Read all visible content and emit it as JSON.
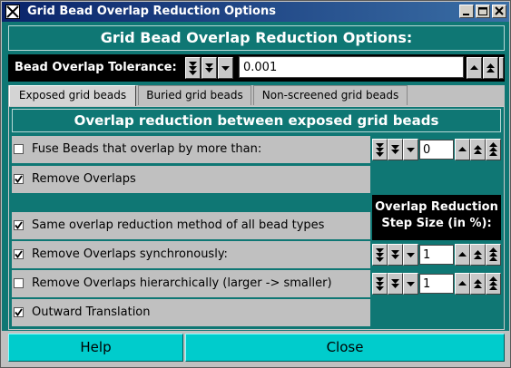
{
  "window": {
    "title": "Grid Bead Overlap Reduction Options"
  },
  "header": {
    "title": "Grid Bead Overlap Reduction Options:"
  },
  "tolerance": {
    "label": "Bead Overlap Tolerance:",
    "value": "0.001"
  },
  "tabs": [
    {
      "label": "Exposed grid beads",
      "active": true
    },
    {
      "label": "Buried grid beads",
      "active": false
    },
    {
      "label": "Non-screened grid beads",
      "active": false
    }
  ],
  "panel": {
    "title": "Overlap reduction between exposed grid beads",
    "step_size_label_line1": "Overlap Reduction",
    "step_size_label_line2": "Step Size (in %):",
    "options": [
      {
        "label": "Fuse Beads that overlap by more than:",
        "checked": false,
        "value": "0"
      },
      {
        "label": "Remove Overlaps",
        "checked": true
      },
      {
        "label": "Same overlap reduction method of all bead types",
        "checked": true
      },
      {
        "label": "Remove Overlaps synchronously:",
        "checked": true,
        "value": "1"
      },
      {
        "label": "Remove Overlaps hierarchically (larger -> smaller)",
        "checked": false,
        "value": "1"
      },
      {
        "label": "Outward Translation",
        "checked": true
      }
    ]
  },
  "footer": {
    "help_label": "Help",
    "close_label": "Close"
  },
  "colors": {
    "teal": "#0f7774",
    "cyan_button": "#00cccc",
    "panel_gray": "#c0c0c0"
  }
}
